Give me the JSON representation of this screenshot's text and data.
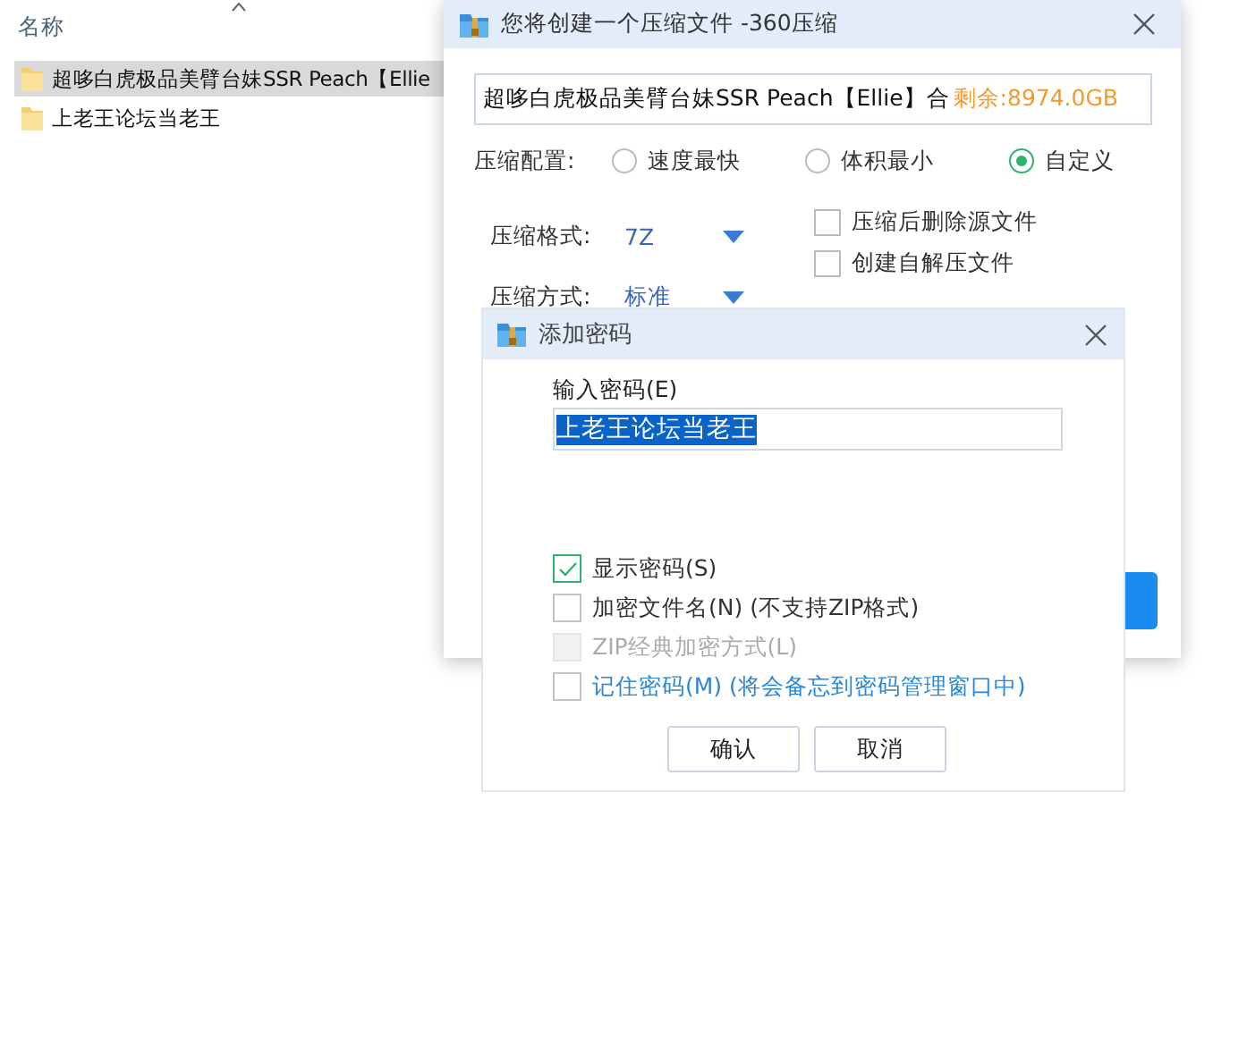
{
  "explorer": {
    "column_header": "名称",
    "files": [
      {
        "name": "超哆白虎极品美臂台妹SSR Peach【Ellie",
        "selected": true
      },
      {
        "name": "上老王论坛当老王",
        "selected": false
      }
    ]
  },
  "compress_window": {
    "title": "您将创建一个压缩文件 -360压缩",
    "path": "超哆白虎极品美臂台妹SSR Peach【Ellie】合",
    "free_space": "剩余:8974.0GB",
    "config_label": "压缩配置:",
    "presets": [
      {
        "label": "速度最快",
        "selected": false
      },
      {
        "label": "体积最小",
        "selected": false
      },
      {
        "label": "自定义",
        "selected": true
      }
    ],
    "format_label": "压缩格式:",
    "format": "7Z",
    "method_label": "压缩方式:",
    "method": "标准",
    "options": [
      {
        "label": "压缩后删除源文件",
        "checked": false
      },
      {
        "label": "创建自解压文件",
        "checked": false
      }
    ]
  },
  "password_dialog": {
    "title": "添加密码",
    "input_label": "输入密码(E)",
    "password": "上老王论坛当老王",
    "options": [
      {
        "kind": "plain",
        "label": "显示密码(S)",
        "checked": true,
        "disabled": false
      },
      {
        "kind": "plain",
        "label": "加密文件名(N) (不支持ZIP格式)",
        "checked": false,
        "disabled": false
      },
      {
        "kind": "plain",
        "label": "ZIP经典加密方式(L)",
        "checked": false,
        "disabled": true
      },
      {
        "kind": "link",
        "label": "记住密码(M) (将会备忘到密码管理窗口中)",
        "checked": false,
        "disabled": false
      }
    ],
    "buttons": [
      "确认",
      "取消"
    ]
  }
}
